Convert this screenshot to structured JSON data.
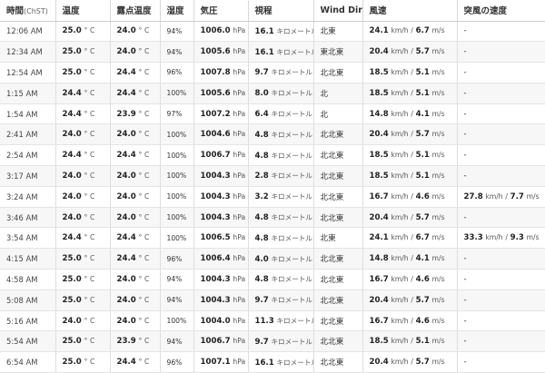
{
  "table": {
    "headers": {
      "time": "時間",
      "time_unit": "(ChST)",
      "temp": "温度",
      "dew": "露点温度",
      "humidity": "湿度",
      "pressure": "気圧",
      "visibility": "視程",
      "wind_dir": "Wind Dir",
      "wind_speed": "風速",
      "gust": "突風の速度"
    },
    "rows": [
      {
        "time": "12:06 AM",
        "temp": "25.0",
        "dew": "24.0",
        "hum": "94%",
        "pres": "1006.0",
        "vis": "16.1",
        "dir": "北東",
        "ws_kmh": "24.1",
        "ws_ms": "6.7",
        "gust": "-",
        "gust_kmh": "",
        "gust_ms": ""
      },
      {
        "time": "12:34 AM",
        "temp": "25.0",
        "dew": "24.0",
        "hum": "94%",
        "pres": "1005.6",
        "vis": "16.1",
        "dir": "東北東",
        "ws_kmh": "20.4",
        "ws_ms": "5.7",
        "gust": "-",
        "gust_kmh": "",
        "gust_ms": ""
      },
      {
        "time": "12:54 AM",
        "temp": "25.0",
        "dew": "24.4",
        "hum": "96%",
        "pres": "1007.8",
        "vis": "9.7",
        "dir": "北北東",
        "ws_kmh": "18.5",
        "ws_ms": "5.1",
        "gust": "-",
        "gust_kmh": "",
        "gust_ms": ""
      },
      {
        "time": "1:15 AM",
        "temp": "24.4",
        "dew": "24.4",
        "hum": "100%",
        "pres": "1005.6",
        "vis": "8.0",
        "dir": "北",
        "ws_kmh": "18.5",
        "ws_ms": "5.1",
        "gust": "-",
        "gust_kmh": "",
        "gust_ms": ""
      },
      {
        "time": "1:54 AM",
        "temp": "24.4",
        "dew": "23.9",
        "hum": "97%",
        "pres": "1007.2",
        "vis": "6.4",
        "dir": "北",
        "ws_kmh": "14.8",
        "ws_ms": "4.1",
        "gust": "-",
        "gust_kmh": "",
        "gust_ms": ""
      },
      {
        "time": "2:41 AM",
        "temp": "24.0",
        "dew": "24.0",
        "hum": "100%",
        "pres": "1004.6",
        "vis": "4.8",
        "dir": "北北東",
        "ws_kmh": "20.4",
        "ws_ms": "5.7",
        "gust": "-",
        "gust_kmh": "",
        "gust_ms": ""
      },
      {
        "time": "2:54 AM",
        "temp": "24.4",
        "dew": "24.4",
        "hum": "100%",
        "pres": "1006.7",
        "vis": "4.8",
        "dir": "北北東",
        "ws_kmh": "18.5",
        "ws_ms": "5.1",
        "gust": "-",
        "gust_kmh": "",
        "gust_ms": ""
      },
      {
        "time": "3:17 AM",
        "temp": "24.0",
        "dew": "24.0",
        "hum": "100%",
        "pres": "1004.3",
        "vis": "2.8",
        "dir": "北北東",
        "ws_kmh": "18.5",
        "ws_ms": "5.1",
        "gust": "-",
        "gust_kmh": "",
        "gust_ms": ""
      },
      {
        "time": "3:24 AM",
        "temp": "24.0",
        "dew": "24.0",
        "hum": "100%",
        "pres": "1004.3",
        "vis": "3.2",
        "dir": "北北東",
        "ws_kmh": "16.7",
        "ws_ms": "4.6",
        "gust": "",
        "gust_kmh": "27.8",
        "gust_ms": "7.7"
      },
      {
        "time": "3:46 AM",
        "temp": "24.0",
        "dew": "24.0",
        "hum": "100%",
        "pres": "1004.3",
        "vis": "4.8",
        "dir": "北北東",
        "ws_kmh": "20.4",
        "ws_ms": "5.7",
        "gust": "-",
        "gust_kmh": "",
        "gust_ms": ""
      },
      {
        "time": "3:54 AM",
        "temp": "24.4",
        "dew": "24.4",
        "hum": "100%",
        "pres": "1006.5",
        "vis": "4.8",
        "dir": "北東",
        "ws_kmh": "24.1",
        "ws_ms": "6.7",
        "gust": "",
        "gust_kmh": "33.3",
        "gust_ms": "9.3"
      },
      {
        "time": "4:15 AM",
        "temp": "25.0",
        "dew": "24.4",
        "hum": "96%",
        "pres": "1006.4",
        "vis": "4.0",
        "dir": "北北東",
        "ws_kmh": "14.8",
        "ws_ms": "4.1",
        "gust": "-",
        "gust_kmh": "",
        "gust_ms": ""
      },
      {
        "time": "4:58 AM",
        "temp": "25.0",
        "dew": "24.0",
        "hum": "94%",
        "pres": "1004.3",
        "vis": "4.8",
        "dir": "北北東",
        "ws_kmh": "16.7",
        "ws_ms": "4.6",
        "gust": "-",
        "gust_kmh": "",
        "gust_ms": ""
      },
      {
        "time": "5:08 AM",
        "temp": "25.0",
        "dew": "24.0",
        "hum": "94%",
        "pres": "1004.3",
        "vis": "9.7",
        "dir": "北北東",
        "ws_kmh": "20.4",
        "ws_ms": "5.7",
        "gust": "-",
        "gust_kmh": "",
        "gust_ms": ""
      },
      {
        "time": "5:16 AM",
        "temp": "24.0",
        "dew": "24.0",
        "hum": "100%",
        "pres": "1004.0",
        "vis": "11.3",
        "dir": "北北東",
        "ws_kmh": "16.7",
        "ws_ms": "4.6",
        "gust": "-",
        "gust_kmh": "",
        "gust_ms": ""
      },
      {
        "time": "5:54 AM",
        "temp": "25.0",
        "dew": "23.9",
        "hum": "94%",
        "pres": "1006.7",
        "vis": "9.7",
        "dir": "北北東",
        "ws_kmh": "18.5",
        "ws_ms": "5.1",
        "gust": "-",
        "gust_kmh": "",
        "gust_ms": ""
      },
      {
        "time": "6:54 AM",
        "temp": "25.0",
        "dew": "24.4",
        "hum": "96%",
        "pres": "1007.1",
        "vis": "16.1",
        "dir": "北北東",
        "ws_kmh": "20.4",
        "ws_ms": "5.7",
        "gust": "-",
        "gust_kmh": "",
        "gust_ms": ""
      }
    ],
    "units": {
      "deg": "°",
      "c": "C",
      "hpa": "hPa",
      "km": "キロメートル",
      "kmh": "km/h",
      "sep": "/",
      "ms": "m/s"
    }
  }
}
